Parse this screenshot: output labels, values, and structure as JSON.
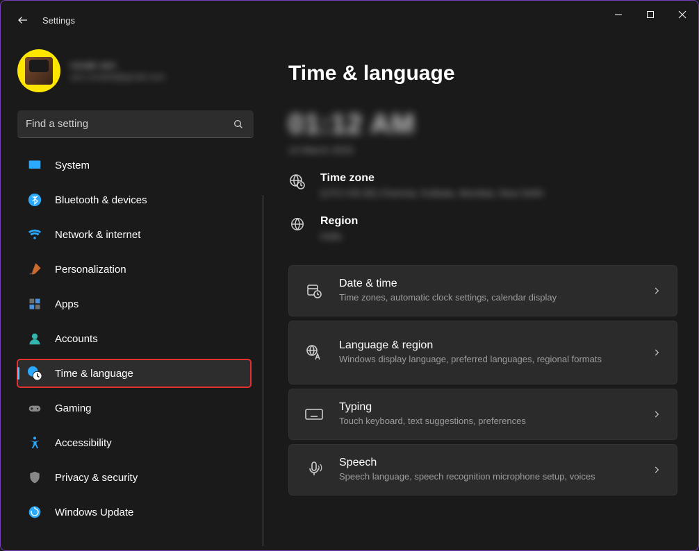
{
  "window": {
    "title": "Settings"
  },
  "user": {
    "name": "ronak sen",
    "email": "sen.ronak9@gmail.com"
  },
  "search": {
    "placeholder": "Find a setting"
  },
  "sidebar": {
    "items": [
      {
        "label": "System",
        "icon": "display-icon",
        "color": "#2aa9ff"
      },
      {
        "label": "Bluetooth & devices",
        "icon": "bluetooth-icon",
        "color": "#2aa9ff"
      },
      {
        "label": "Network & internet",
        "icon": "wifi-icon",
        "color": "#2aa9ff"
      },
      {
        "label": "Personalization",
        "icon": "brush-icon",
        "color": "#c86a2e"
      },
      {
        "label": "Apps",
        "icon": "apps-icon",
        "color": "#777777"
      },
      {
        "label": "Accounts",
        "icon": "person-icon",
        "color": "#33b4ad"
      },
      {
        "label": "Time & language",
        "icon": "clock-globe-icon",
        "color": "#2aa9ff",
        "selected": true,
        "highlighted": true
      },
      {
        "label": "Gaming",
        "icon": "gamepad-icon",
        "color": "#888888"
      },
      {
        "label": "Accessibility",
        "icon": "accessibility-icon",
        "color": "#2aa9ff"
      },
      {
        "label": "Privacy & security",
        "icon": "shield-icon",
        "color": "#888888"
      },
      {
        "label": "Windows Update",
        "icon": "update-icon",
        "color": "#2aa9ff"
      }
    ]
  },
  "page": {
    "title": "Time & language",
    "time": "01:12 AM",
    "date": "14 March 2023",
    "info": [
      {
        "title": "Time zone",
        "value": "(UTC+05:30) Chennai, Kolkata, Mumbai, New Delhi",
        "icon": "globe-clock-icon"
      },
      {
        "title": "Region",
        "value": "India",
        "icon": "globe-icon"
      }
    ],
    "cards": [
      {
        "title": "Date & time",
        "desc": "Time zones, automatic clock settings, calendar display",
        "icon": "calendar-clock-icon"
      },
      {
        "title": "Language & region",
        "desc": "Windows display language, preferred languages, regional formats",
        "icon": "language-icon",
        "tall": true
      },
      {
        "title": "Typing",
        "desc": "Touch keyboard, text suggestions, preferences",
        "icon": "keyboard-icon"
      },
      {
        "title": "Speech",
        "desc": "Speech language, speech recognition microphone setup, voices",
        "icon": "speech-icon"
      }
    ]
  }
}
